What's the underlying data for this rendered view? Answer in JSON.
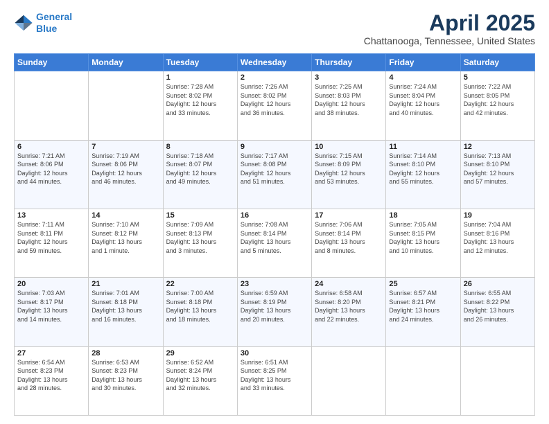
{
  "header": {
    "logo_line1": "General",
    "logo_line2": "Blue",
    "month": "April 2025",
    "location": "Chattanooga, Tennessee, United States"
  },
  "weekdays": [
    "Sunday",
    "Monday",
    "Tuesday",
    "Wednesday",
    "Thursday",
    "Friday",
    "Saturday"
  ],
  "weeks": [
    [
      {
        "day": "",
        "info": ""
      },
      {
        "day": "",
        "info": ""
      },
      {
        "day": "1",
        "info": "Sunrise: 7:28 AM\nSunset: 8:02 PM\nDaylight: 12 hours\nand 33 minutes."
      },
      {
        "day": "2",
        "info": "Sunrise: 7:26 AM\nSunset: 8:02 PM\nDaylight: 12 hours\nand 36 minutes."
      },
      {
        "day": "3",
        "info": "Sunrise: 7:25 AM\nSunset: 8:03 PM\nDaylight: 12 hours\nand 38 minutes."
      },
      {
        "day": "4",
        "info": "Sunrise: 7:24 AM\nSunset: 8:04 PM\nDaylight: 12 hours\nand 40 minutes."
      },
      {
        "day": "5",
        "info": "Sunrise: 7:22 AM\nSunset: 8:05 PM\nDaylight: 12 hours\nand 42 minutes."
      }
    ],
    [
      {
        "day": "6",
        "info": "Sunrise: 7:21 AM\nSunset: 8:06 PM\nDaylight: 12 hours\nand 44 minutes."
      },
      {
        "day": "7",
        "info": "Sunrise: 7:19 AM\nSunset: 8:06 PM\nDaylight: 12 hours\nand 46 minutes."
      },
      {
        "day": "8",
        "info": "Sunrise: 7:18 AM\nSunset: 8:07 PM\nDaylight: 12 hours\nand 49 minutes."
      },
      {
        "day": "9",
        "info": "Sunrise: 7:17 AM\nSunset: 8:08 PM\nDaylight: 12 hours\nand 51 minutes."
      },
      {
        "day": "10",
        "info": "Sunrise: 7:15 AM\nSunset: 8:09 PM\nDaylight: 12 hours\nand 53 minutes."
      },
      {
        "day": "11",
        "info": "Sunrise: 7:14 AM\nSunset: 8:10 PM\nDaylight: 12 hours\nand 55 minutes."
      },
      {
        "day": "12",
        "info": "Sunrise: 7:13 AM\nSunset: 8:10 PM\nDaylight: 12 hours\nand 57 minutes."
      }
    ],
    [
      {
        "day": "13",
        "info": "Sunrise: 7:11 AM\nSunset: 8:11 PM\nDaylight: 12 hours\nand 59 minutes."
      },
      {
        "day": "14",
        "info": "Sunrise: 7:10 AM\nSunset: 8:12 PM\nDaylight: 13 hours\nand 1 minute."
      },
      {
        "day": "15",
        "info": "Sunrise: 7:09 AM\nSunset: 8:13 PM\nDaylight: 13 hours\nand 3 minutes."
      },
      {
        "day": "16",
        "info": "Sunrise: 7:08 AM\nSunset: 8:14 PM\nDaylight: 13 hours\nand 5 minutes."
      },
      {
        "day": "17",
        "info": "Sunrise: 7:06 AM\nSunset: 8:14 PM\nDaylight: 13 hours\nand 8 minutes."
      },
      {
        "day": "18",
        "info": "Sunrise: 7:05 AM\nSunset: 8:15 PM\nDaylight: 13 hours\nand 10 minutes."
      },
      {
        "day": "19",
        "info": "Sunrise: 7:04 AM\nSunset: 8:16 PM\nDaylight: 13 hours\nand 12 minutes."
      }
    ],
    [
      {
        "day": "20",
        "info": "Sunrise: 7:03 AM\nSunset: 8:17 PM\nDaylight: 13 hours\nand 14 minutes."
      },
      {
        "day": "21",
        "info": "Sunrise: 7:01 AM\nSunset: 8:18 PM\nDaylight: 13 hours\nand 16 minutes."
      },
      {
        "day": "22",
        "info": "Sunrise: 7:00 AM\nSunset: 8:18 PM\nDaylight: 13 hours\nand 18 minutes."
      },
      {
        "day": "23",
        "info": "Sunrise: 6:59 AM\nSunset: 8:19 PM\nDaylight: 13 hours\nand 20 minutes."
      },
      {
        "day": "24",
        "info": "Sunrise: 6:58 AM\nSunset: 8:20 PM\nDaylight: 13 hours\nand 22 minutes."
      },
      {
        "day": "25",
        "info": "Sunrise: 6:57 AM\nSunset: 8:21 PM\nDaylight: 13 hours\nand 24 minutes."
      },
      {
        "day": "26",
        "info": "Sunrise: 6:55 AM\nSunset: 8:22 PM\nDaylight: 13 hours\nand 26 minutes."
      }
    ],
    [
      {
        "day": "27",
        "info": "Sunrise: 6:54 AM\nSunset: 8:23 PM\nDaylight: 13 hours\nand 28 minutes."
      },
      {
        "day": "28",
        "info": "Sunrise: 6:53 AM\nSunset: 8:23 PM\nDaylight: 13 hours\nand 30 minutes."
      },
      {
        "day": "29",
        "info": "Sunrise: 6:52 AM\nSunset: 8:24 PM\nDaylight: 13 hours\nand 32 minutes."
      },
      {
        "day": "30",
        "info": "Sunrise: 6:51 AM\nSunset: 8:25 PM\nDaylight: 13 hours\nand 33 minutes."
      },
      {
        "day": "",
        "info": ""
      },
      {
        "day": "",
        "info": ""
      },
      {
        "day": "",
        "info": ""
      }
    ]
  ]
}
